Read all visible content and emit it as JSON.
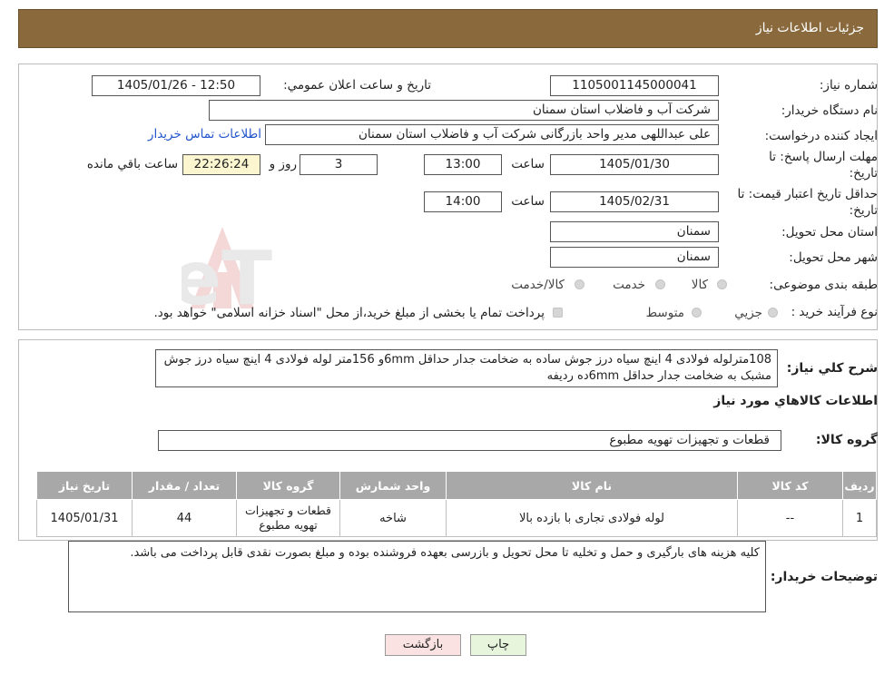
{
  "header": {
    "title": "جزئیات اطلاعات نیاز"
  },
  "form": {
    "need_number_label": "شماره نیاز:",
    "need_number": "1105001145000041",
    "announce_label": "تاریخ و ساعت اعلان عمومي:",
    "announce_value": "1405/01/26 - 12:50",
    "buyer_org_label": "نام دستگاه خريدار:",
    "buyer_org": "شرکت آب و فاضلاب استان سمنان",
    "requester_label": "ايجاد کننده درخواست:",
    "requester": "علی عبداللهی مدیر واحد بازرگانی شرکت آب و فاضلاب استان سمنان",
    "contact_link": "اطلاعات تماس خريدار",
    "deadline_label_1": "مهلت ارسال پاسخ: تا",
    "deadline_label_2": "تاریخ:",
    "deadline_date": "1405/01/30",
    "time_label": "ساعت",
    "deadline_time": "13:00",
    "days_value": "3",
    "days_label": "روز و",
    "remaining_time": "22:26:24",
    "remaining_label": "ساعت باقي مانده",
    "validity_label_1": "حداقل تاريخ اعتبار قيمت: تا",
    "validity_label_2": "تاریخ:",
    "validity_date": "1405/02/31",
    "validity_time": "14:00",
    "province_label": "استان محل تحويل:",
    "province": "سمنان",
    "city_label": "شهر محل تحويل:",
    "city": "سمنان",
    "category_label": "طبقه بندی موضوعی:",
    "cat_goods": "کالا",
    "cat_service": "خدمت",
    "cat_both": "کالا/خدمت",
    "process_label": "نوع فرآيند خريد :",
    "proc_partial": "جزيي",
    "proc_medium": "متوسط",
    "proc_note": "پرداخت تمام يا بخشی از مبلغ خريد،از محل \"اسناد خزانه اسلامی\" خواهد بود."
  },
  "summary": {
    "label": "شرح کلي نياز:",
    "text": "108مترلوله فولادی 4 اینچ سیاه درز جوش ساده به ضخامت جدار حداقل 6mmو 156متر لوله فولادی 4 اینچ سیاه درز جوش مشبک به ضخامت جدار حداقل 6mmده ردیفه"
  },
  "goods_info_title": "اطلاعات کالاهاي مورد نياز",
  "goods_group": {
    "label": "گروه کالا:",
    "value": "قطعات و تجهیزات تهویه مطبوع"
  },
  "table": {
    "headers": [
      "رديف",
      "کد کالا",
      "نام کالا",
      "واحد شمارش",
      "گروه کالا",
      "تعداد / مقدار",
      "تاريخ نياز"
    ],
    "rows": [
      {
        "row": "1",
        "code": "--",
        "name": "لوله فولادی تجاری با بازده بالا",
        "unit": "شاخه",
        "group": "قطعات و تجهيزات تهويه مطبوع",
        "qty": "44",
        "date": "1405/01/31"
      }
    ]
  },
  "buyer_notes": {
    "label": "توضيحات خريدار:",
    "text": "کلیه هزینه های بارگیری و حمل و تخلیه تا محل تحویل و بازرسی بعهده فروشنده بوده و مبلغ بصورت نقدی قابل پرداخت می باشد."
  },
  "buttons": {
    "print": "چاپ",
    "back": "بازگشت"
  },
  "colors": {
    "header_bg": "#8a6a3d",
    "link": "#2255cc",
    "table_header": "#a8a8a8",
    "print_btn": "#e6f5dc",
    "back_btn": "#fbe2e2"
  },
  "watermark": "AriaTender.neT"
}
